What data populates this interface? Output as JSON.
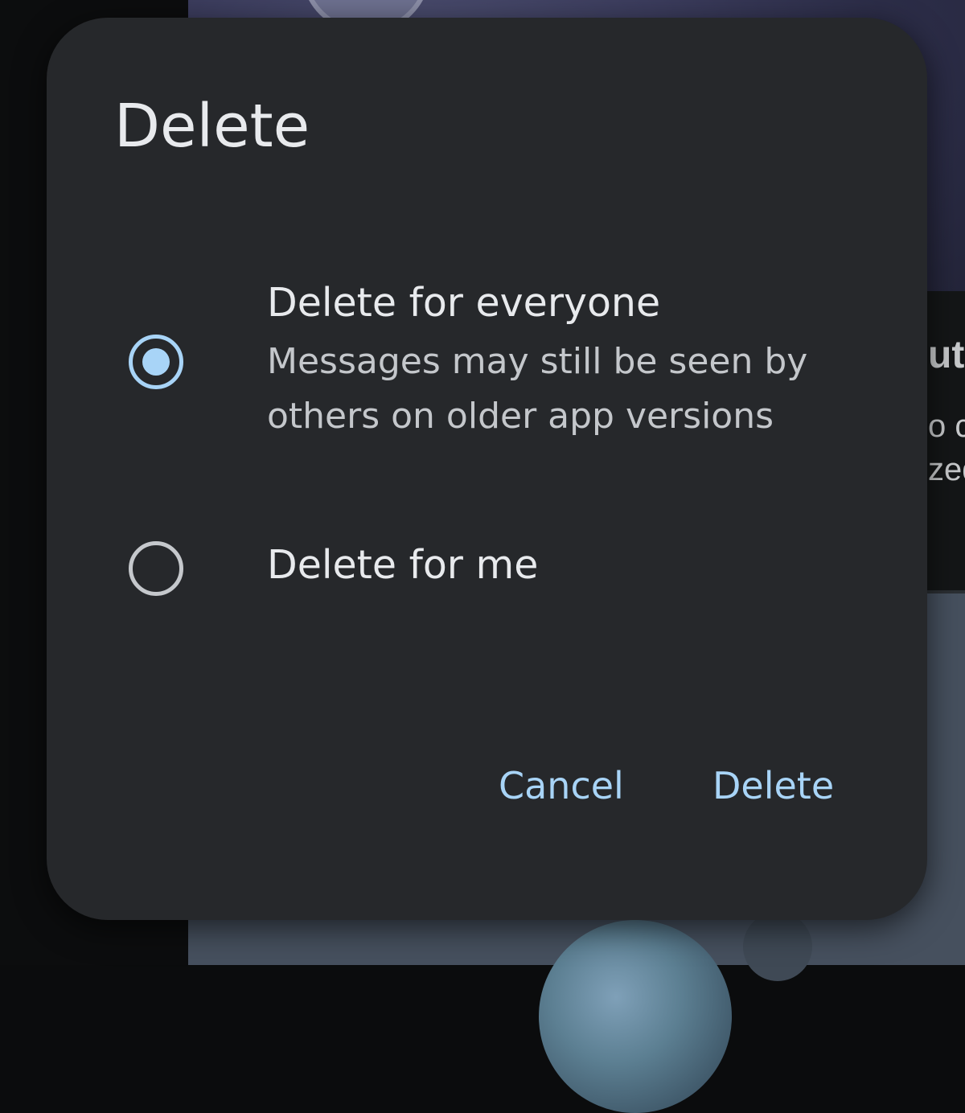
{
  "dialog": {
    "title": "Delete",
    "options": [
      {
        "label": "Delete for everyone",
        "description": "Messages may still be seen by others on older app versions",
        "selected": true
      },
      {
        "label": "Delete for me",
        "description": "",
        "selected": false
      }
    ],
    "buttons": {
      "cancel": "Cancel",
      "delete": "Delete"
    }
  },
  "background": {
    "peek_text": [
      "ute",
      "o c",
      "zed"
    ]
  },
  "colors": {
    "dialog_bg": "#26282b",
    "accent": "#a8d4f7",
    "text_primary": "#e8eaed",
    "text_secondary": "#c4c7cb"
  }
}
